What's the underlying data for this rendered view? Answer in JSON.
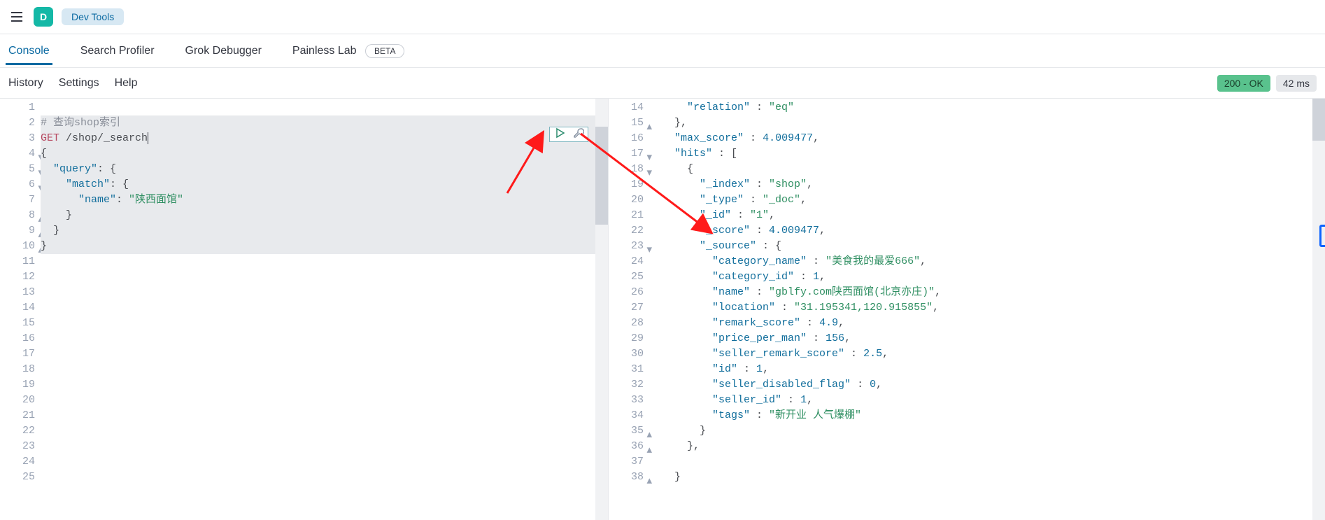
{
  "header": {
    "logo_letter": "D",
    "breadcrumb": "Dev Tools"
  },
  "tabs": {
    "items": [
      "Console",
      "Search Profiler",
      "Grok Debugger",
      "Painless Lab"
    ],
    "active_index": 0,
    "beta_label": "BETA"
  },
  "subbar": {
    "items": [
      "History",
      "Settings",
      "Help"
    ],
    "status": "200 - OK",
    "time": "42 ms"
  },
  "editor_left": {
    "start_line": 1,
    "lines": [
      {
        "n": 1,
        "text": ""
      },
      {
        "n": 2,
        "text": "# 查询shop索引",
        "cls": "c-comment"
      },
      {
        "n": 3,
        "method": "GET",
        "path": "/shop/_search",
        "cursor": true
      },
      {
        "n": 4,
        "text": "{",
        "arrow": "down"
      },
      {
        "n": 5,
        "indent": "  ",
        "key": "\"query\"",
        "post": ": {",
        "arrow": "down"
      },
      {
        "n": 6,
        "indent": "    ",
        "key": "\"match\"",
        "post": ": {",
        "arrow": "down"
      },
      {
        "n": 7,
        "indent": "      ",
        "key": "\"name\"",
        "post": ": ",
        "str": "\"陕西面馆\""
      },
      {
        "n": 8,
        "indent": "    ",
        "text": "}",
        "arrow": "up"
      },
      {
        "n": 9,
        "indent": "  ",
        "text": "}",
        "arrow": "up"
      },
      {
        "n": 10,
        "text": "}",
        "arrow": "up"
      },
      {
        "n": 11,
        "text": ""
      },
      {
        "n": 12,
        "text": ""
      },
      {
        "n": 13,
        "text": ""
      },
      {
        "n": 14,
        "text": ""
      },
      {
        "n": 15,
        "text": ""
      },
      {
        "n": 16,
        "text": ""
      },
      {
        "n": 17,
        "text": ""
      },
      {
        "n": 18,
        "text": ""
      },
      {
        "n": 19,
        "text": ""
      },
      {
        "n": 20,
        "text": ""
      },
      {
        "n": 21,
        "text": ""
      },
      {
        "n": 22,
        "text": ""
      },
      {
        "n": 23,
        "text": ""
      },
      {
        "n": 24,
        "text": ""
      },
      {
        "n": 25,
        "text": ""
      }
    ]
  },
  "editor_right": {
    "lines": [
      {
        "n": 14,
        "indent": "      ",
        "key": "\"relation\"",
        "post": " : ",
        "str": "\"eq\""
      },
      {
        "n": 15,
        "indent": "    ",
        "text": "},",
        "arrow": "up"
      },
      {
        "n": 16,
        "indent": "    ",
        "key": "\"max_score\"",
        "post": " : ",
        "num": "4.009477",
        "tail": ","
      },
      {
        "n": 17,
        "indent": "    ",
        "key": "\"hits\"",
        "post": " : [",
        "arrow": "down"
      },
      {
        "n": 18,
        "indent": "      ",
        "text": "{",
        "arrow": "down"
      },
      {
        "n": 19,
        "indent": "        ",
        "key": "\"_index\"",
        "post": " : ",
        "str": "\"shop\"",
        "tail": ","
      },
      {
        "n": 20,
        "indent": "        ",
        "key": "\"_type\"",
        "post": " : ",
        "str": "\"_doc\"",
        "tail": ","
      },
      {
        "n": 21,
        "indent": "        ",
        "key": "\"_id\"",
        "post": " : ",
        "str": "\"1\"",
        "tail": ","
      },
      {
        "n": 22,
        "indent": "        ",
        "key": "\"_score\"",
        "post": " : ",
        "num": "4.009477",
        "tail": ","
      },
      {
        "n": 23,
        "indent": "        ",
        "key": "\"_source\"",
        "post": " : {",
        "arrow": "down"
      },
      {
        "n": 24,
        "indent": "          ",
        "key": "\"category_name\"",
        "post": " : ",
        "str": "\"美食我的最爱666\"",
        "tail": ","
      },
      {
        "n": 25,
        "indent": "          ",
        "key": "\"category_id\"",
        "post": " : ",
        "num": "1",
        "tail": ","
      },
      {
        "n": 26,
        "indent": "          ",
        "key": "\"name\"",
        "post": " : ",
        "str": "\"gblfy.com陕西面馆(北京亦庄)\"",
        "tail": ","
      },
      {
        "n": 27,
        "indent": "          ",
        "key": "\"location\"",
        "post": " : ",
        "str": "\"31.195341,120.915855\"",
        "tail": ","
      },
      {
        "n": 28,
        "indent": "          ",
        "key": "\"remark_score\"",
        "post": " : ",
        "num": "4.9",
        "tail": ","
      },
      {
        "n": 29,
        "indent": "          ",
        "key": "\"price_per_man\"",
        "post": " : ",
        "num": "156",
        "tail": ","
      },
      {
        "n": 30,
        "indent": "          ",
        "key": "\"seller_remark_score\"",
        "post": " : ",
        "num": "2.5",
        "tail": ","
      },
      {
        "n": 31,
        "indent": "          ",
        "key": "\"id\"",
        "post": " : ",
        "num": "1",
        "tail": ","
      },
      {
        "n": 32,
        "indent": "          ",
        "key": "\"seller_disabled_flag\"",
        "post": " : ",
        "num": "0",
        "tail": ","
      },
      {
        "n": 33,
        "indent": "          ",
        "key": "\"seller_id\"",
        "post": " : ",
        "num": "1",
        "tail": ","
      },
      {
        "n": 34,
        "indent": "          ",
        "key": "\"tags\"",
        "post": " : ",
        "str": "\"新开业 人气爆棚\""
      },
      {
        "n": 35,
        "indent": "        ",
        "text": "}",
        "arrow": "up"
      },
      {
        "n": 36,
        "indent": "      ",
        "text": "},",
        "arrow": "up"
      },
      {
        "n": 37,
        "text": ""
      },
      {
        "n": 38,
        "indent": "    ",
        "text": "}",
        "arrow": "up"
      }
    ]
  },
  "icons": {
    "hamburger": "menu-icon",
    "play": "play-icon",
    "wrench": "wrench-icon",
    "splitter": "splitter-icon"
  }
}
